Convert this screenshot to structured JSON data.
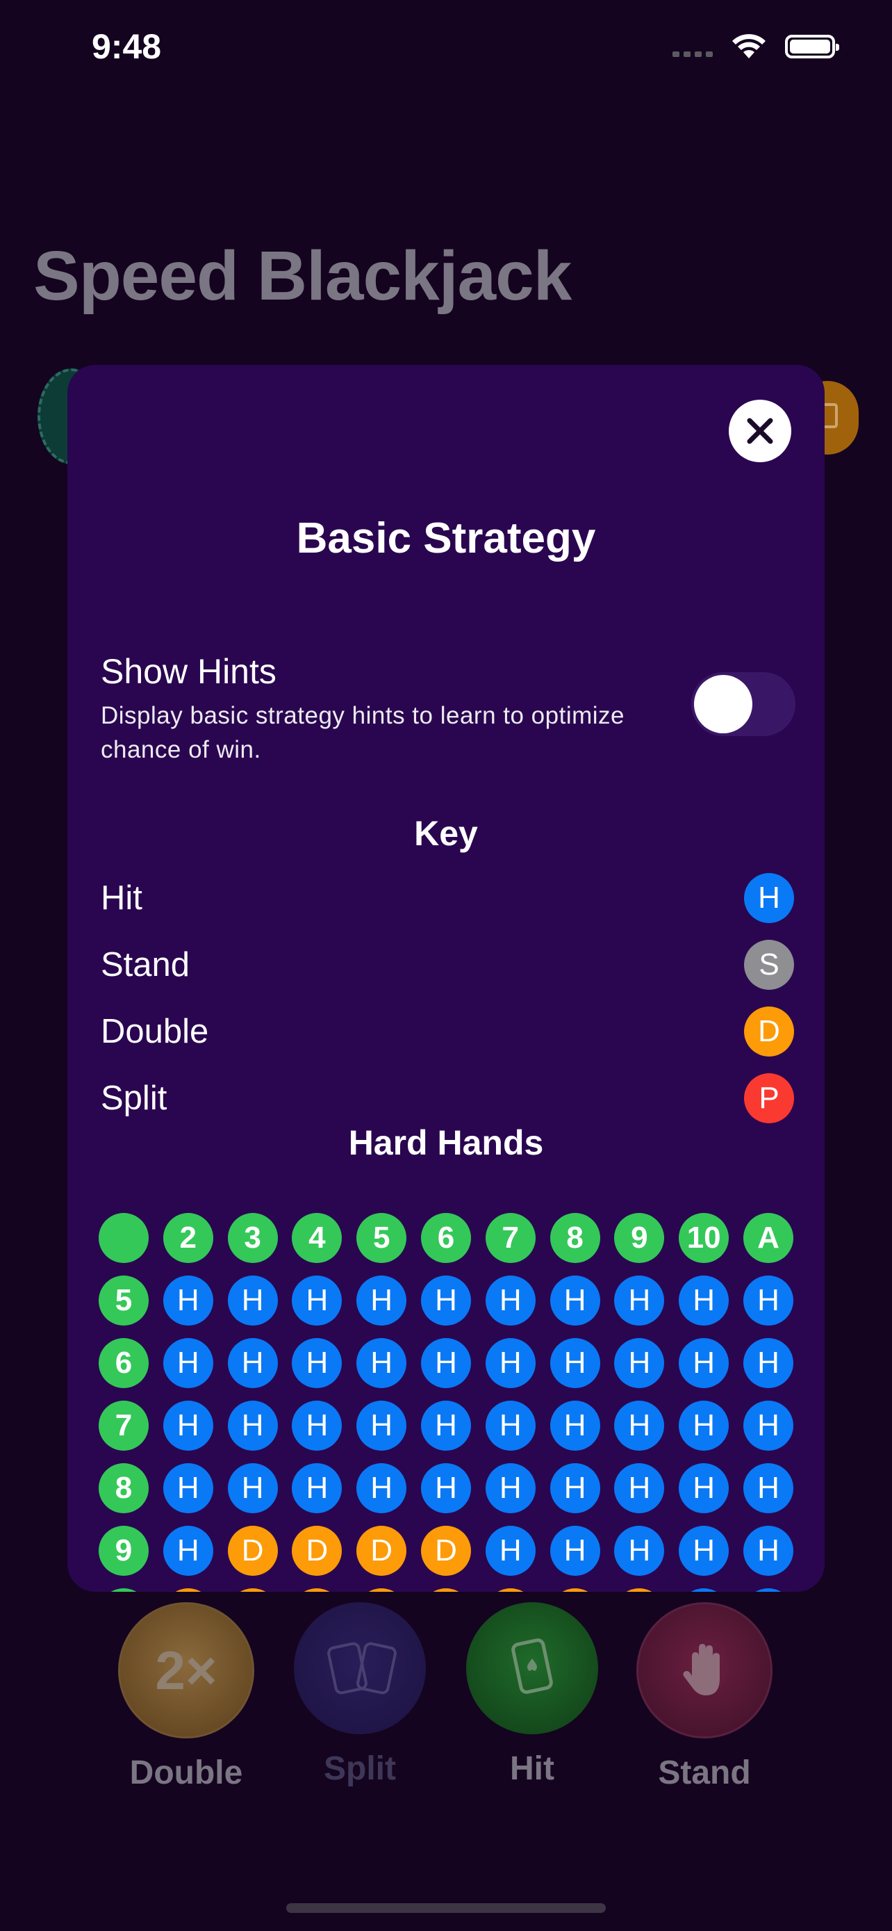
{
  "status": {
    "time": "9:48"
  },
  "app": {
    "title": "Speed Blackjack"
  },
  "modal": {
    "title": "Basic Strategy",
    "hints": {
      "title": "Show Hints",
      "description": "Display basic strategy hints to learn to optimize chance of win.",
      "enabled": false
    },
    "key": {
      "title": "Key",
      "items": [
        {
          "label": "Hit",
          "code": "H",
          "color": "#0A79F5"
        },
        {
          "label": "Stand",
          "code": "S",
          "color": "#8E8E93"
        },
        {
          "label": "Double",
          "code": "D",
          "color": "#FD9B09"
        },
        {
          "label": "Split",
          "code": "P",
          "color": "#FA3A31"
        }
      ]
    },
    "hard_hands": {
      "title": "Hard Hands",
      "dealer_header": [
        "",
        "2",
        "3",
        "4",
        "5",
        "6",
        "7",
        "8",
        "9",
        "10",
        "A"
      ],
      "rows": [
        {
          "player": "5",
          "actions": [
            "H",
            "H",
            "H",
            "H",
            "H",
            "H",
            "H",
            "H",
            "H",
            "H"
          ]
        },
        {
          "player": "6",
          "actions": [
            "H",
            "H",
            "H",
            "H",
            "H",
            "H",
            "H",
            "H",
            "H",
            "H"
          ]
        },
        {
          "player": "7",
          "actions": [
            "H",
            "H",
            "H",
            "H",
            "H",
            "H",
            "H",
            "H",
            "H",
            "H"
          ]
        },
        {
          "player": "8",
          "actions": [
            "H",
            "H",
            "H",
            "H",
            "H",
            "H",
            "H",
            "H",
            "H",
            "H"
          ]
        },
        {
          "player": "9",
          "actions": [
            "H",
            "D",
            "D",
            "D",
            "D",
            "H",
            "H",
            "H",
            "H",
            "H"
          ]
        }
      ]
    }
  },
  "actions": {
    "double": {
      "label": "Double",
      "glyph": "2×"
    },
    "split": {
      "label": "Split"
    },
    "hit": {
      "label": "Hit"
    },
    "stand": {
      "label": "Stand"
    }
  },
  "colors": {
    "background": "#14041F",
    "modal": "#2A0650",
    "hit": "#0A79F5",
    "stand": "#8E8E93",
    "double": "#FD9B09",
    "split": "#FA3A31",
    "header": "#34C859"
  }
}
